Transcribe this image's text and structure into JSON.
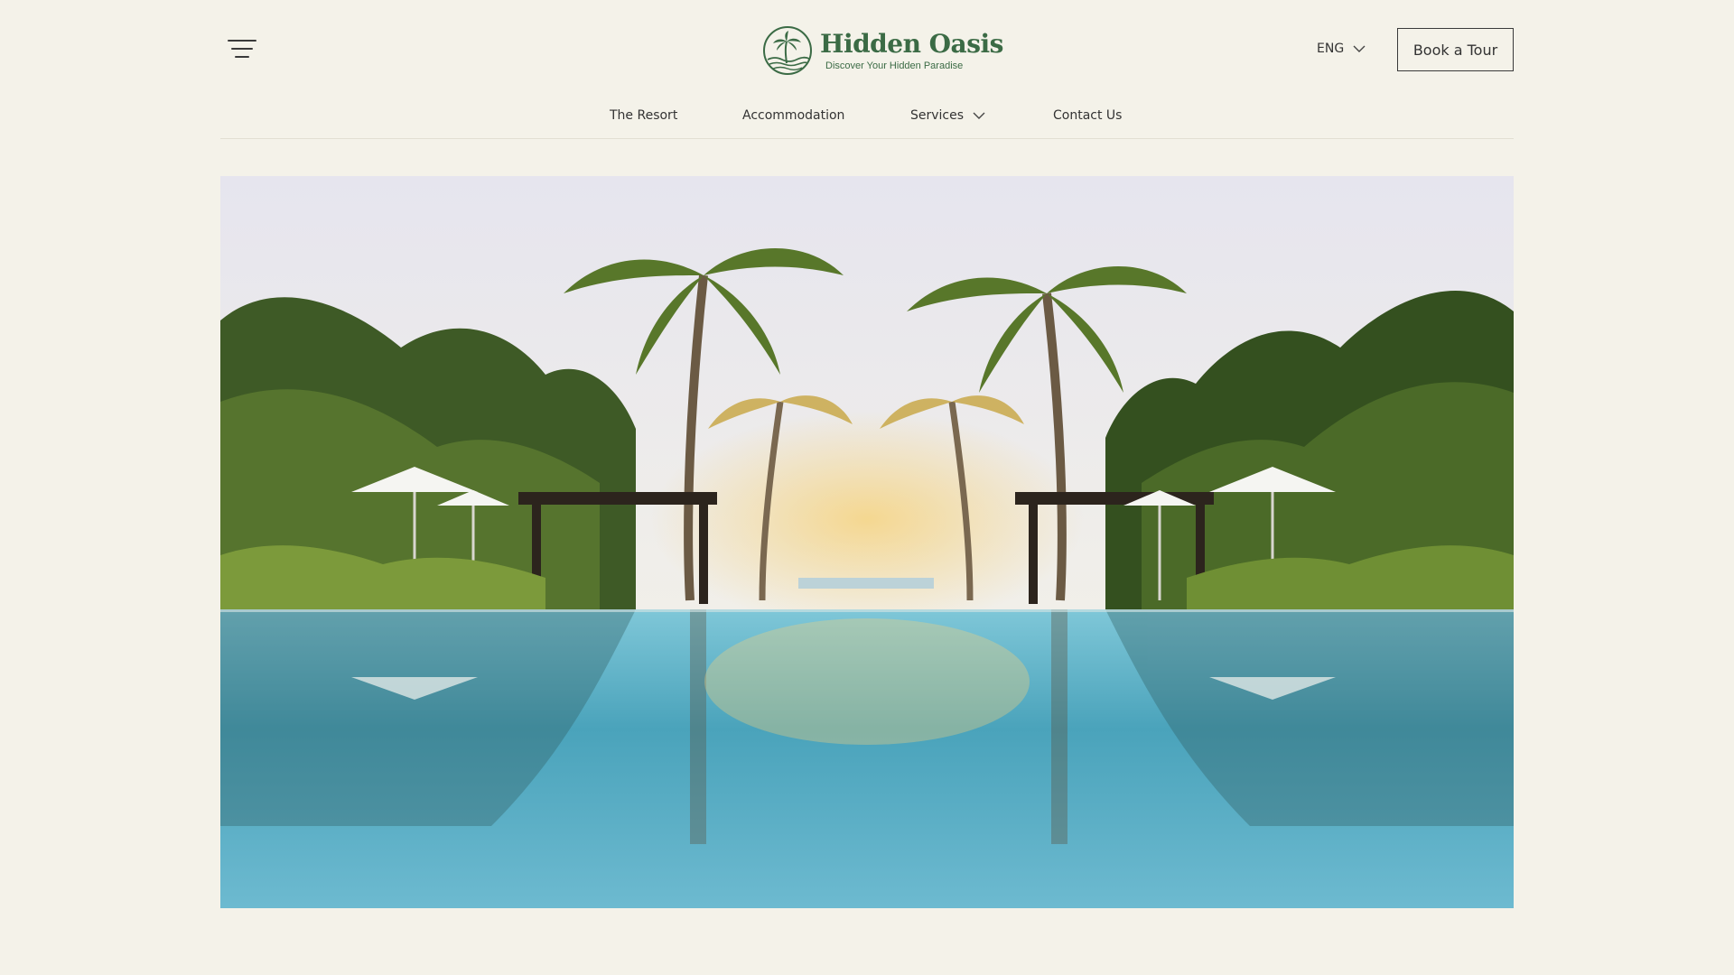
{
  "header": {
    "menu_icon": "hamburger-menu-icon",
    "logo": {
      "icon": "palm-island-logo-icon",
      "title": "Hidden Oasis",
      "tagline": "Discover Your Hidden Paradise",
      "color": "#3b6b45"
    },
    "language": {
      "value": "ENG",
      "icon": "chevron-down-icon"
    },
    "cta_label": "Book a Tour"
  },
  "nav": {
    "items": [
      {
        "label": "The Resort"
      },
      {
        "label": "Accommodation"
      },
      {
        "label": "Services",
        "icon": "chevron-down-icon"
      },
      {
        "label": "Contact Us"
      }
    ]
  },
  "hero": {
    "image": "resort-infinity-pool-with-palm-trees",
    "colors": {
      "sky": "#e9e8ef",
      "pool": "#4aa3bb",
      "foliage": "#3d5a25",
      "background": "#f4f2e9"
    }
  }
}
